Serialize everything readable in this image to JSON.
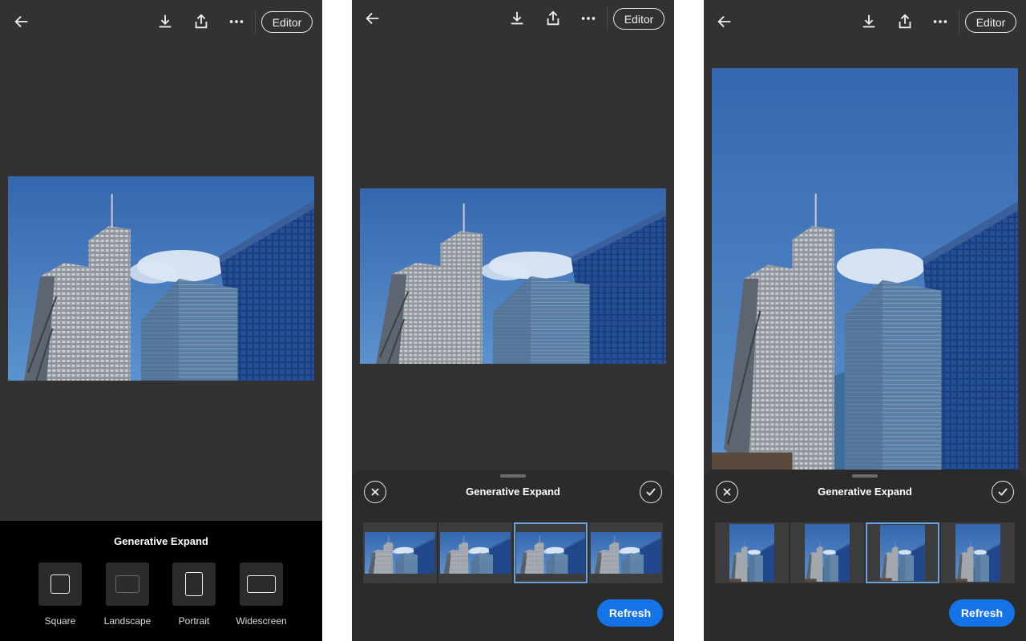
{
  "panel1": {
    "editor_label": "Editor",
    "sheet_title": "Generative Expand",
    "options": [
      {
        "label": "Square"
      },
      {
        "label": "Landscape"
      },
      {
        "label": "Portrait"
      },
      {
        "label": "Widescreen"
      }
    ]
  },
  "panel2": {
    "editor_label": "Editor",
    "sheet_title": "Generative Expand",
    "refresh_label": "Refresh",
    "selected_variation": 3
  },
  "panel3": {
    "editor_label": "Editor",
    "sheet_title": "Generative Expand",
    "refresh_label": "Refresh",
    "selected_variation": 3
  },
  "colors": {
    "app_background": "#323232",
    "sheet_black": "#000000",
    "sheet_dark": "#2b2b2b",
    "accent_blue": "#1473e6",
    "selection_outline": "#6aa3dc",
    "sky": "#3f74b8"
  },
  "icons": [
    "back-arrow-icon",
    "download-icon",
    "share-icon",
    "more-icon",
    "close-icon",
    "checkmark-icon"
  ]
}
